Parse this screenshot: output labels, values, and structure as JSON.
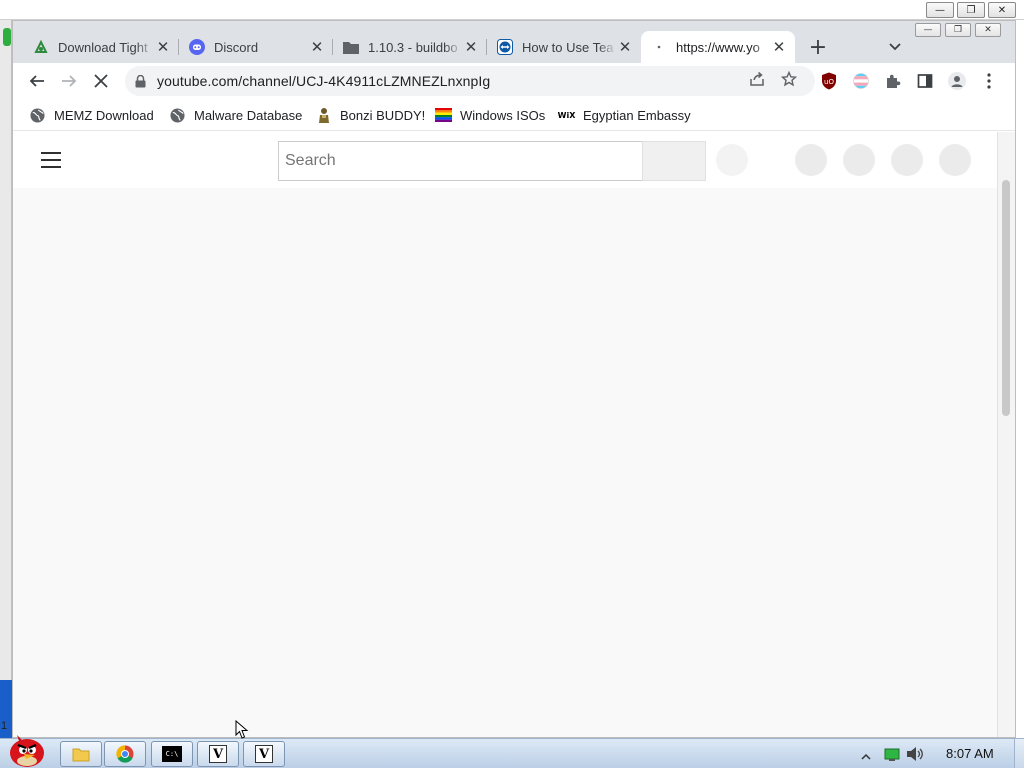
{
  "host": {
    "controls": [
      "minimize",
      "restore",
      "close"
    ]
  },
  "left_edge": {
    "label": "1"
  },
  "tabs": [
    {
      "title": "Download Tight",
      "icon": "tightvnc-icon",
      "active": false
    },
    {
      "title": "Discord",
      "icon": "discord-icon",
      "active": false
    },
    {
      "title": "1.10.3 - buildbo",
      "icon": "folder-icon",
      "active": false
    },
    {
      "title": "How to Use Tea",
      "icon": "teamviewer-icon",
      "active": false
    },
    {
      "title": "https://www.yo",
      "icon": "loading-icon",
      "active": true
    }
  ],
  "tab_close_glyph": "✕",
  "new_tab_glyph": "+",
  "toolbar": {
    "url": "youtube.com/channel/UCJ-4K4911cLZMNEZLnxnpIg"
  },
  "bookmarks": [
    {
      "label": "MEMZ Download",
      "icon": "globe-icon"
    },
    {
      "label": "Malware Database",
      "icon": "globe-icon"
    },
    {
      "label": "Bonzi BUDDY!",
      "icon": "bonzi-icon"
    },
    {
      "label": "Windows ISOs",
      "icon": "rainbow-flag-icon"
    },
    {
      "label": "Egyptian Embassy",
      "icon": "wix-icon"
    }
  ],
  "bookmark_wix_text": "WiX",
  "page": {
    "search_placeholder": "Search"
  },
  "taskbar": {
    "clock": "8:07 AM",
    "items": [
      "explorer",
      "chrome",
      "cmd",
      "vmware",
      "vmware"
    ],
    "vm_glyph": "V",
    "cmd_glyph": "C:\\"
  },
  "colors": {
    "tabstrip": "#dee1e6",
    "omnibox": "#f1f3f4",
    "page_bg": "#f9f9f9",
    "taskbar": "#c8d9ec",
    "ublock_red": "#800000",
    "discord": "#5865f2",
    "teamviewer": "#0e5aa7"
  }
}
